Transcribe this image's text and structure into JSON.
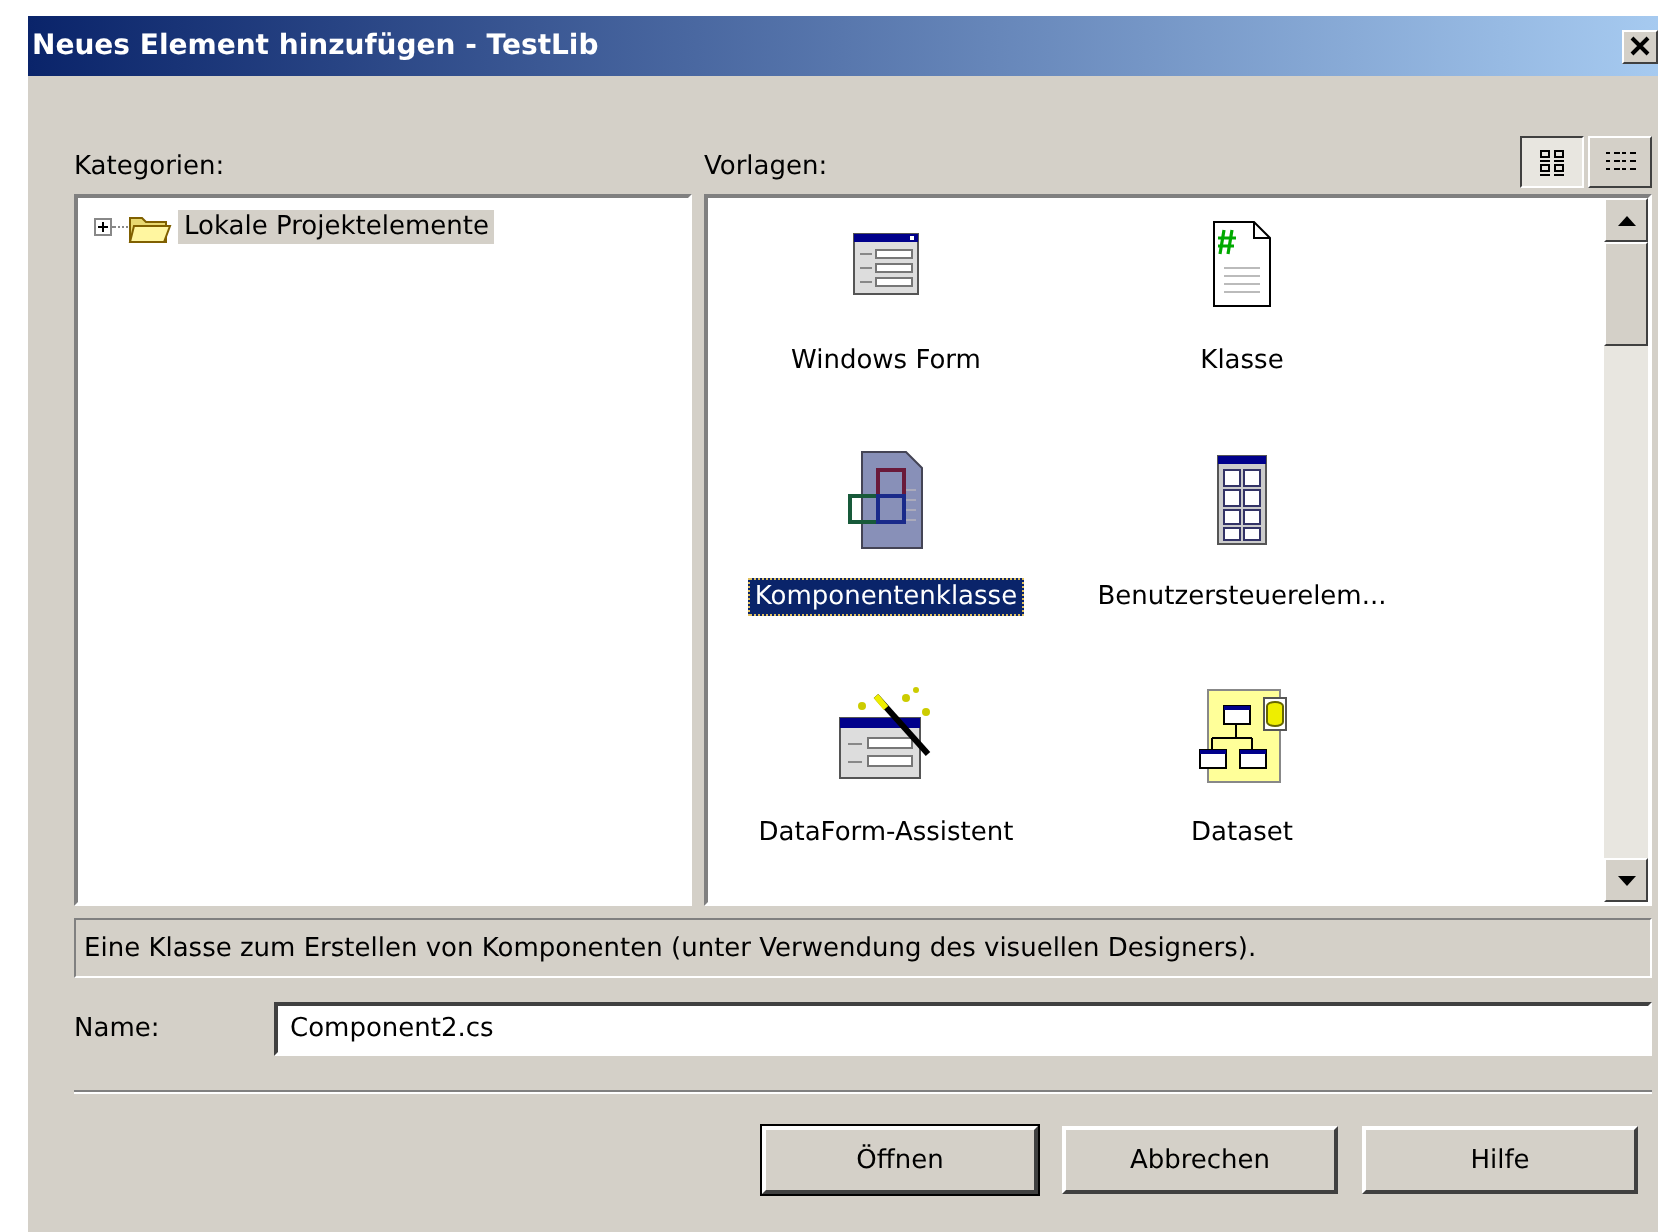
{
  "window": {
    "title": "Neues Element hinzufügen - TestLib"
  },
  "categories": {
    "label": "Kategorien:",
    "items": [
      {
        "label": "Lokale Projektelemente",
        "expanded": false,
        "selected": true
      }
    ]
  },
  "templates": {
    "label": "Vorlagen:",
    "view_buttons": [
      {
        "kind": "large",
        "selected": true
      },
      {
        "kind": "small",
        "selected": false
      }
    ],
    "items": [
      {
        "label": "Windows Form",
        "kind": "form",
        "selected": false
      },
      {
        "label": "Klasse",
        "kind": "class",
        "selected": false
      },
      {
        "label": "Komponentenklasse",
        "kind": "component",
        "selected": true
      },
      {
        "label": "Benutzersteuerelem...",
        "kind": "control",
        "selected": false
      },
      {
        "label": "DataForm-Assistent",
        "kind": "wizard",
        "selected": false
      },
      {
        "label": "Dataset",
        "kind": "dataset",
        "selected": false
      }
    ]
  },
  "description": "Eine Klasse zum Erstellen von Komponenten (unter Verwendung des visuellen Designers).",
  "name_field": {
    "label": "Name:",
    "value": "Component2.cs"
  },
  "buttons": [
    {
      "label": "Öffnen",
      "default": true
    },
    {
      "label": "Abbrechen",
      "default": false
    },
    {
      "label": "Hilfe",
      "default": false
    }
  ]
}
